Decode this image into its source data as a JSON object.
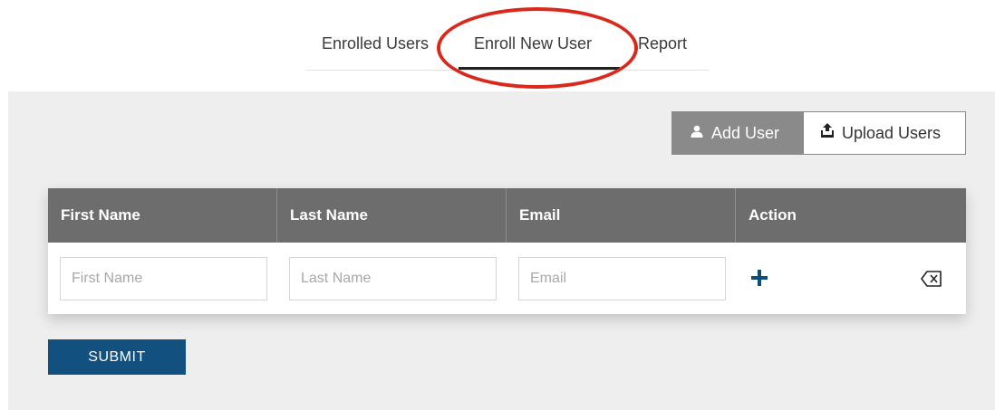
{
  "tabs": [
    {
      "label": "Enrolled Users",
      "active": false
    },
    {
      "label": "Enroll New User",
      "active": true
    },
    {
      "label": "Report",
      "active": false
    }
  ],
  "toolbar": {
    "add_user_label": "Add User",
    "add_user_icon": "user-icon",
    "upload_users_label": "Upload Users",
    "upload_users_icon": "upload-icon"
  },
  "table": {
    "columns": [
      "First Name",
      "Last Name",
      "Email",
      "Action"
    ],
    "row": {
      "first_name": {
        "value": "",
        "placeholder": "First Name"
      },
      "last_name": {
        "value": "",
        "placeholder": "Last Name"
      },
      "email": {
        "value": "",
        "placeholder": "Email"
      },
      "actions": [
        "plus-icon",
        "backspace-delete-icon"
      ]
    }
  },
  "submit_label": "SUBMIT",
  "colors": {
    "header_bg": "#6d6d6d",
    "add_button_bg": "#8a8a8a",
    "accent": "#11507f",
    "annotation": "#d9291c",
    "panel_bg": "#eeeeee"
  }
}
